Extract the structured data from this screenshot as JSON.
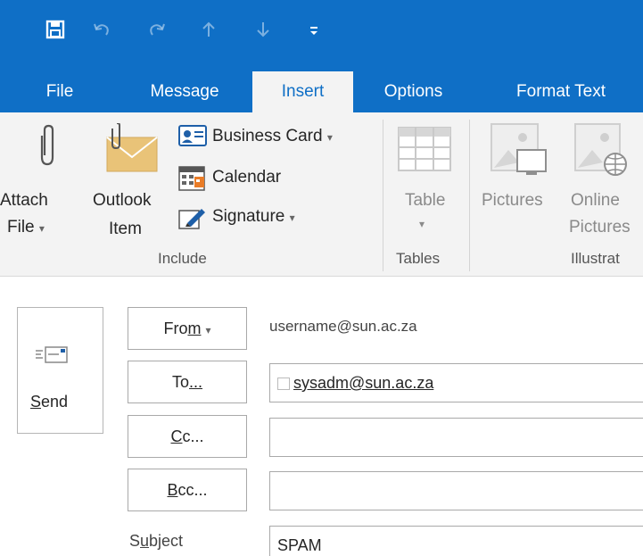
{
  "quick_access": {
    "icons": [
      "save-icon",
      "undo-icon",
      "redo-icon",
      "up-icon",
      "down-icon",
      "customize-icon"
    ]
  },
  "tabs": [
    {
      "label": "File"
    },
    {
      "label": "Message"
    },
    {
      "label": "Insert"
    },
    {
      "label": "Options"
    },
    {
      "label": "Format Text"
    }
  ],
  "ribbon": {
    "attach_file": {
      "line1": "Attach",
      "line2": "File"
    },
    "outlook_item": {
      "line1": "Outlook",
      "line2": "Item"
    },
    "business_card": "Business Card",
    "calendar": "Calendar",
    "signature": "Signature",
    "table": "Table",
    "pictures": "Pictures",
    "online_pictures": {
      "line1": "Online",
      "line2": "Pictures"
    },
    "groups": {
      "include": "Include",
      "tables": "Tables",
      "illustrations": "Illustrat"
    }
  },
  "compose": {
    "send_label": {
      "u": "S",
      "rest": "end"
    },
    "from_button": {
      "pre": "Fro",
      "u": "m",
      "post": ""
    },
    "from_value": "username@sun.ac.za",
    "to_button": {
      "pre": "To",
      "u": "...",
      "post": ""
    },
    "to_value": "sysadm@sun.ac.za",
    "cc_button": {
      "pre": "",
      "u": "C",
      "post": "c..."
    },
    "cc_value": "",
    "bcc_button": {
      "pre": "",
      "u": "B",
      "post": "cc..."
    },
    "bcc_value": "",
    "subject_label": {
      "pre": "S",
      "u": "u",
      "post": "bject"
    },
    "subject_value": "SPAM"
  }
}
